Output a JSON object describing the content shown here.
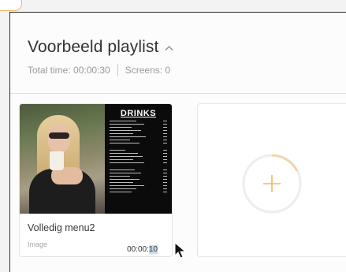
{
  "playlist": {
    "title": "Voorbeeld playlist",
    "total_time_label": "Total time: 00:00:30",
    "screens_label": "Screens: 0"
  },
  "items": [
    {
      "name": "Volledig menu2",
      "type": "Image",
      "duration_prefix": "00:00:",
      "duration_selected": "10",
      "thumbnail_heading": "DRINKS"
    }
  ],
  "add_card": {
    "icon": "plus-icon"
  },
  "colors": {
    "accent": "#f0b862",
    "selection": "#c8d9f2",
    "border": "#e4e4e4"
  }
}
